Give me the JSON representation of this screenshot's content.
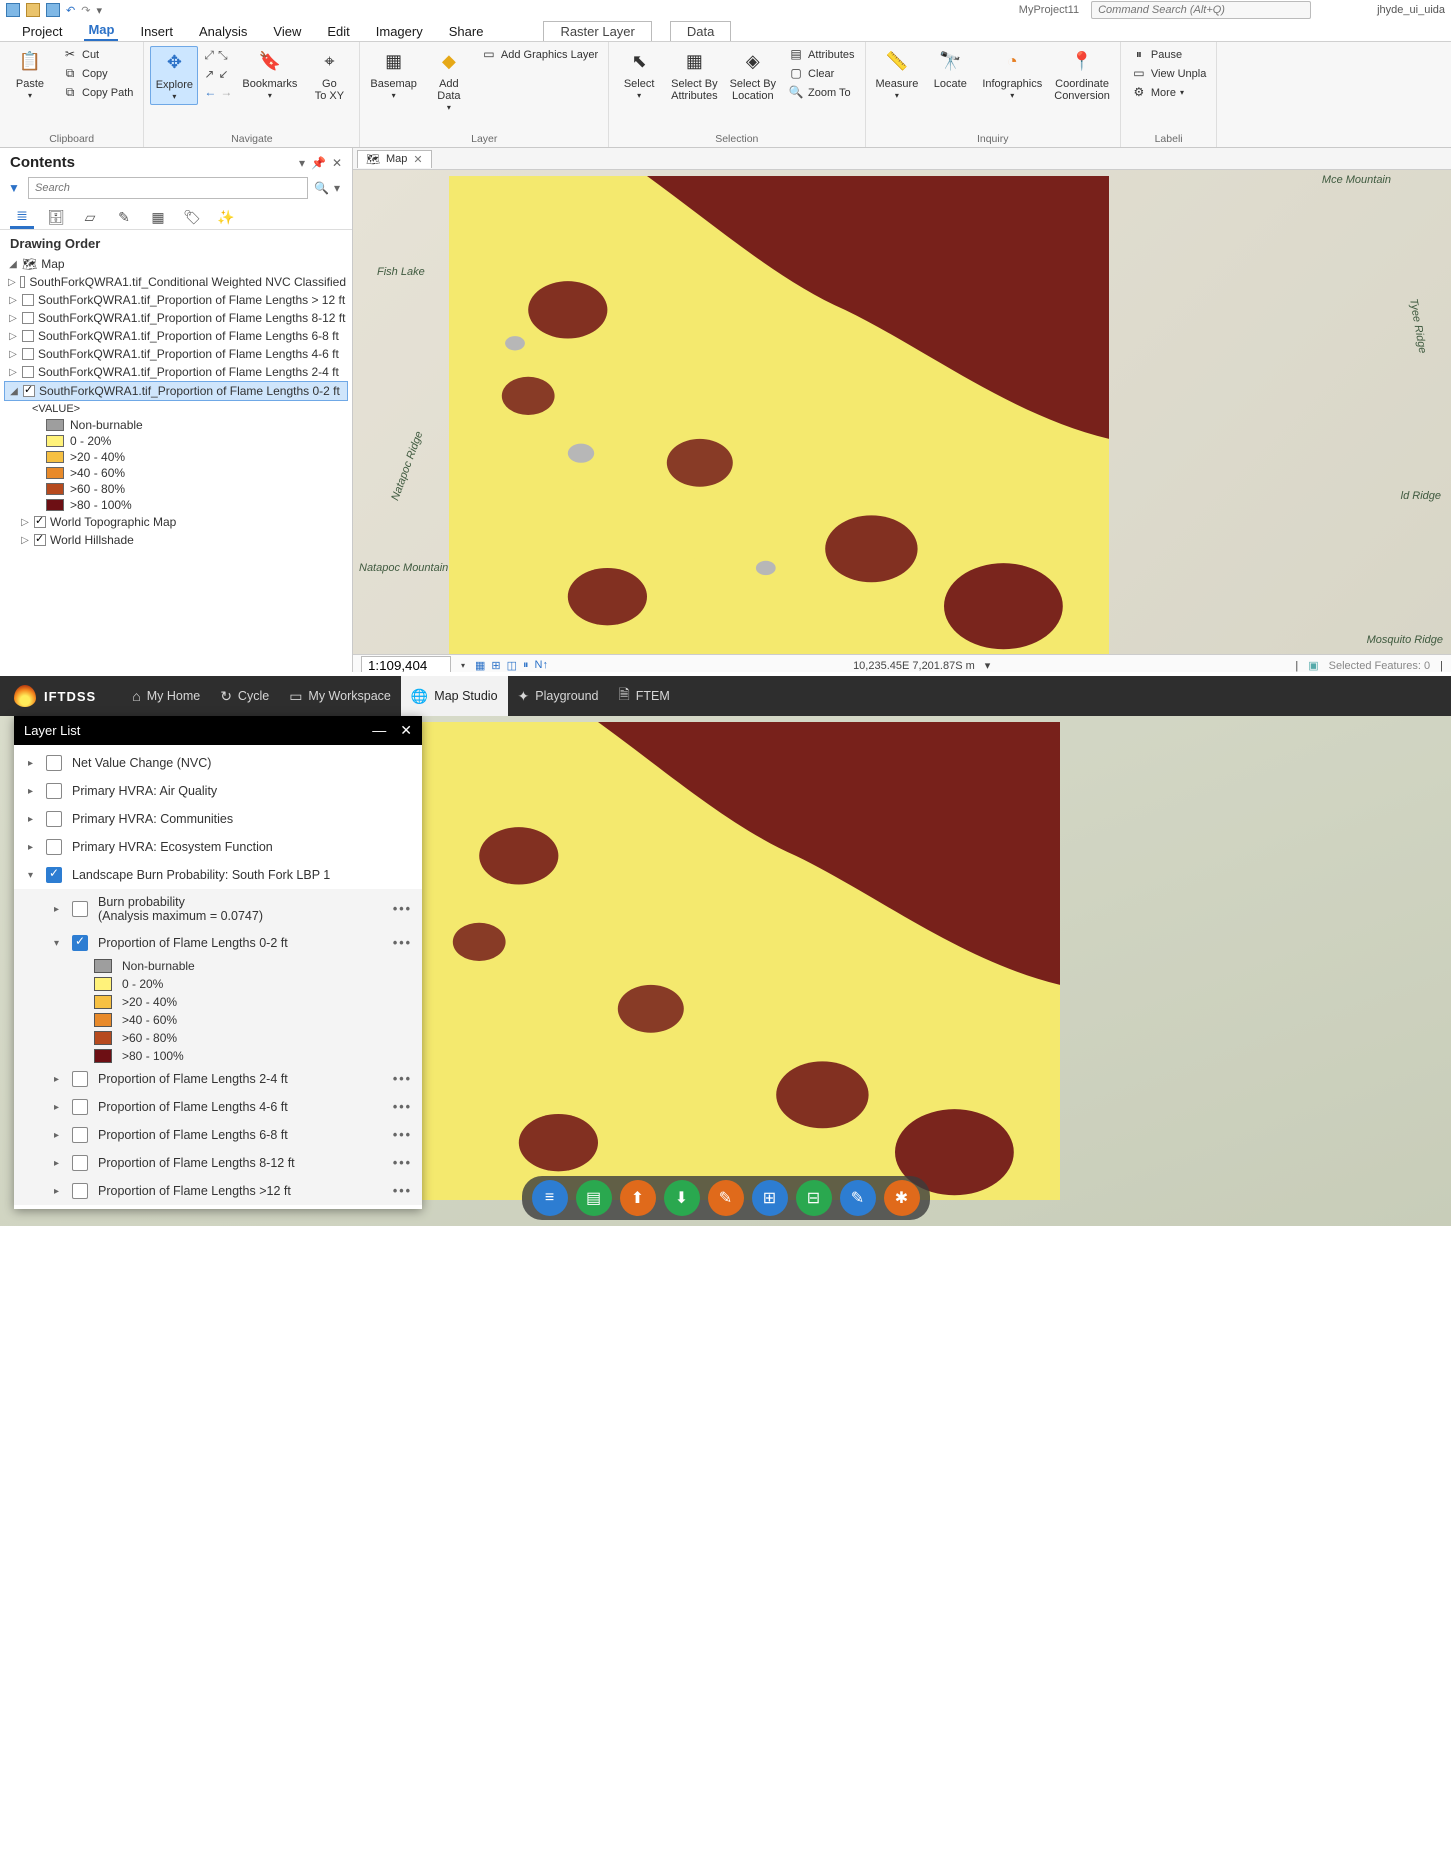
{
  "top": {
    "qat": {
      "project": "MyProject11",
      "command_search_placeholder": "Command Search (Alt+Q)",
      "user": "jhyde_ui_uida"
    },
    "menu": {
      "items": [
        "Project",
        "Map",
        "Insert",
        "Analysis",
        "View",
        "Edit",
        "Imagery",
        "Share"
      ],
      "active": "Map",
      "context_tabs": [
        "Raster Layer",
        "Data"
      ]
    },
    "ribbon": {
      "clipboard": {
        "paste": "Paste",
        "cut": "Cut",
        "copy": "Copy",
        "copy_path": "Copy Path",
        "label": "Clipboard"
      },
      "navigate": {
        "explore": "Explore",
        "bookmarks": "Bookmarks",
        "goto": "Go\nTo XY",
        "label": "Navigate"
      },
      "layer": {
        "basemap": "Basemap",
        "add_data": "Add\nData",
        "add_graphics": "Add Graphics Layer",
        "label": "Layer"
      },
      "selection": {
        "select": "Select",
        "by_attr": "Select By\nAttributes",
        "by_loc": "Select By\nLocation",
        "attributes": "Attributes",
        "clear": "Clear",
        "zoom_to": "Zoom To",
        "label": "Selection"
      },
      "inquiry": {
        "measure": "Measure",
        "locate": "Locate",
        "infographics": "Infographics",
        "coord": "Coordinate\nConversion",
        "label": "Inquiry"
      },
      "labeling": {
        "pause": "Pause",
        "view_unplaced": "View Unpla",
        "more": "More",
        "label": "Labeli"
      }
    },
    "contents": {
      "title": "Contents",
      "search_placeholder": "Search",
      "drawing_order": "Drawing Order",
      "root": "Map",
      "layers": [
        {
          "name": "SouthForkQWRA1.tif_Conditional Weighted NVC Classified",
          "checked": false
        },
        {
          "name": "SouthForkQWRA1.tif_Proportion of Flame Lengths > 12 ft",
          "checked": false
        },
        {
          "name": "SouthForkQWRA1.tif_Proportion of Flame Lengths 8-12 ft",
          "checked": false
        },
        {
          "name": "SouthForkQWRA1.tif_Proportion of Flame Lengths 6-8 ft",
          "checked": false
        },
        {
          "name": "SouthForkQWRA1.tif_Proportion of Flame Lengths 4-6 ft",
          "checked": false
        },
        {
          "name": "SouthForkQWRA1.tif_Proportion of Flame Lengths 2-4 ft",
          "checked": false
        },
        {
          "name": "SouthForkQWRA1.tif_Proportion of Flame Lengths 0-2 ft",
          "checked": true,
          "selected": true,
          "expanded": true
        }
      ],
      "value_header": "<VALUE>",
      "symbology": [
        {
          "label": "Non-burnable",
          "color": "#9e9e9e"
        },
        {
          "label": "0 - 20%",
          "color": "#fff27a"
        },
        {
          "label": ">20 - 40%",
          "color": "#f6c042"
        },
        {
          "label": ">40 - 60%",
          "color": "#e88a2a"
        },
        {
          "label": ">60 - 80%",
          "color": "#b64a1e"
        },
        {
          "label": ">80 - 100%",
          "color": "#6d0f14"
        }
      ],
      "base_layers": [
        {
          "name": "World Topographic Map",
          "checked": true
        },
        {
          "name": "World Hillshade",
          "checked": true
        }
      ]
    },
    "map": {
      "tab_label": "Map",
      "terrain_labels": [
        "Fish Lake",
        "Natapoc Ridge",
        "Natapoc Mountain",
        "Tyee Ridge",
        "ld Ridge",
        "Mosquito Ridge",
        "Mce Mountain"
      ],
      "scale": "1:109,404",
      "coords": "10,235.45E 7,201.87S m",
      "selected_features": "Selected Features: 0"
    }
  },
  "bottom": {
    "brand": "IFTDSS",
    "nav": [
      {
        "icon": "⌂",
        "label": "My Home"
      },
      {
        "icon": "↻",
        "label": "Cycle"
      },
      {
        "icon": "▭",
        "label": "My Workspace"
      },
      {
        "icon": "🌐",
        "label": "Map Studio",
        "active": true
      },
      {
        "icon": "✦",
        "label": "Playground"
      },
      {
        "icon": "🗎",
        "label": "FTEM"
      }
    ],
    "layerlist": {
      "title": "Layer List",
      "items": [
        {
          "label": "Net Value Change (NVC)",
          "checked": false
        },
        {
          "label": "Primary HVRA: Air Quality",
          "checked": false
        },
        {
          "label": "Primary HVRA: Communities",
          "checked": false
        },
        {
          "label": "Primary HVRA: Ecosystem Function",
          "checked": false
        },
        {
          "label": "Landscape Burn Probability: South Fork LBP 1",
          "checked": true,
          "expanded": true,
          "children": [
            {
              "label": "Burn probability\n(Analysis maximum = 0.0747)",
              "checked": false,
              "dots": true
            },
            {
              "label": "Proportion of Flame Lengths 0-2 ft",
              "checked": true,
              "dots": true,
              "expanded": true,
              "symbology": [
                {
                  "label": "Non-burnable",
                  "color": "#9e9e9e"
                },
                {
                  "label": "0 - 20%",
                  "color": "#fff27a"
                },
                {
                  "label": ">20 - 40%",
                  "color": "#f6c042"
                },
                {
                  "label": ">40 - 60%",
                  "color": "#e88a2a"
                },
                {
                  "label": ">60 - 80%",
                  "color": "#b64a1e"
                },
                {
                  "label": ">80 - 100%",
                  "color": "#6d0f14"
                }
              ]
            },
            {
              "label": "Proportion of Flame Lengths 2-4 ft",
              "checked": false,
              "dots": true
            },
            {
              "label": "Proportion of Flame Lengths 4-6 ft",
              "checked": false,
              "dots": true
            },
            {
              "label": "Proportion of Flame Lengths 6-8 ft",
              "checked": false,
              "dots": true
            },
            {
              "label": "Proportion of Flame Lengths 8-12 ft",
              "checked": false,
              "dots": true
            },
            {
              "label": "Proportion of Flame Lengths >12 ft",
              "checked": false,
              "dots": true
            }
          ]
        }
      ]
    },
    "toolbar_colors": [
      "#2d7dd2",
      "#2aa84f",
      "#e06a1b",
      "#2aa84f",
      "#e06a1b",
      "#2d7dd2",
      "#2aa84f",
      "#2d7dd2",
      "#e06a1b"
    ],
    "toolbar_icons": [
      "≡",
      "▤",
      "⬆",
      "⬇",
      "✎",
      "⊞",
      "⊟",
      "✎",
      "✱"
    ]
  }
}
